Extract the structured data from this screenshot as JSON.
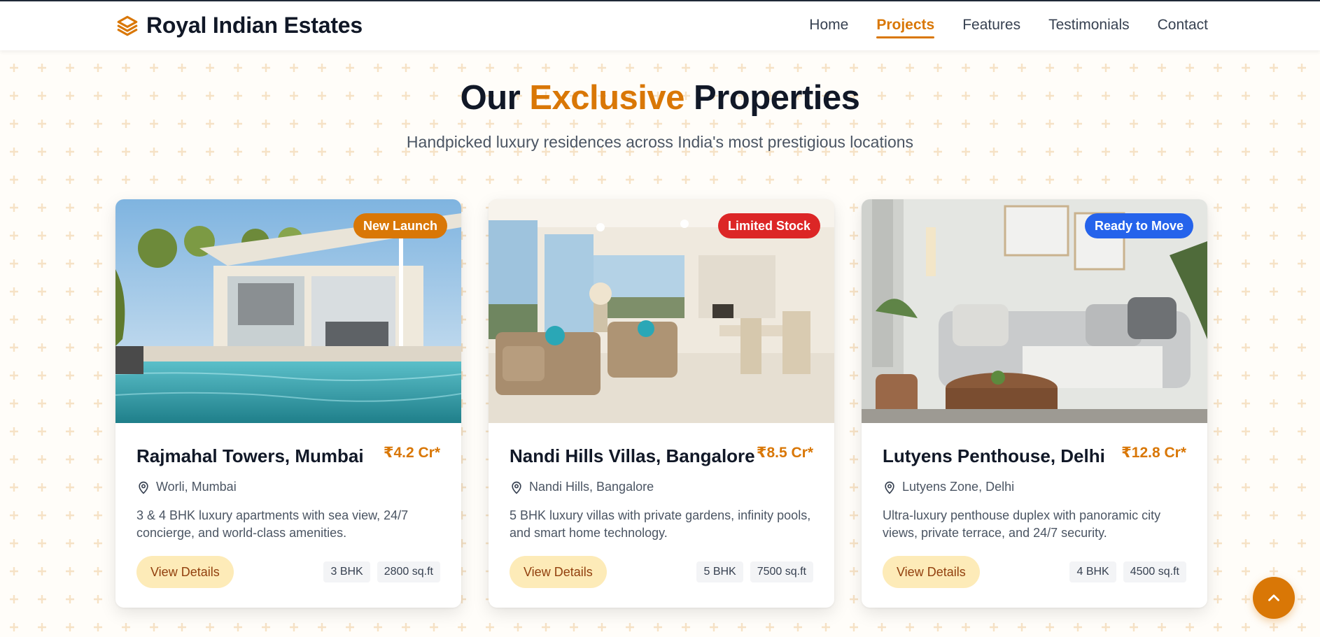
{
  "brand": {
    "name": "Royal Indian Estates",
    "accent_color": "#d97706"
  },
  "nav": {
    "items": [
      {
        "label": "Home",
        "active": false
      },
      {
        "label": "Projects",
        "active": true
      },
      {
        "label": "Features",
        "active": false
      },
      {
        "label": "Testimonials",
        "active": false
      },
      {
        "label": "Contact",
        "active": false
      }
    ]
  },
  "hero": {
    "title_before": "Our ",
    "title_accent": "Exclusive",
    "title_after": " Properties",
    "subtitle": "Handpicked luxury residences across India's most prestigious locations"
  },
  "properties": [
    {
      "badge": "New Launch",
      "badge_color": "#d97706",
      "title": "Rajmahal Towers, Mumbai",
      "price": "₹4.2 Cr*",
      "location": "Worli, Mumbai",
      "description": "3 & 4 BHK luxury apartments with sea view, 24/7 concierge, and world-class amenities.",
      "button": "View Details",
      "config": "3 BHK",
      "area": "2800 sq.ft",
      "image_icon": "poolside-villa-photo"
    },
    {
      "badge": "Limited Stock",
      "badge_color": "#dc2626",
      "title": "Nandi Hills Villas, Bangalore",
      "price": "₹8.5 Cr*",
      "location": "Nandi Hills, Bangalore",
      "description": "5 BHK luxury villas with private gardens, infinity pools, and smart home technology.",
      "button": "View Details",
      "config": "5 BHK",
      "area": "7500 sq.ft",
      "image_icon": "living-room-photo"
    },
    {
      "badge": "Ready to Move",
      "badge_color": "#2563eb",
      "title": "Lutyens Penthouse, Delhi",
      "price": "₹12.8 Cr*",
      "location": "Lutyens Zone, Delhi",
      "description": "Ultra-luxury penthouse duplex with panoramic city views, private terrace, and 24/7 security.",
      "button": "View Details",
      "config": "4 BHK",
      "area": "4500 sq.ft",
      "image_icon": "sofa-lounge-photo"
    }
  ]
}
